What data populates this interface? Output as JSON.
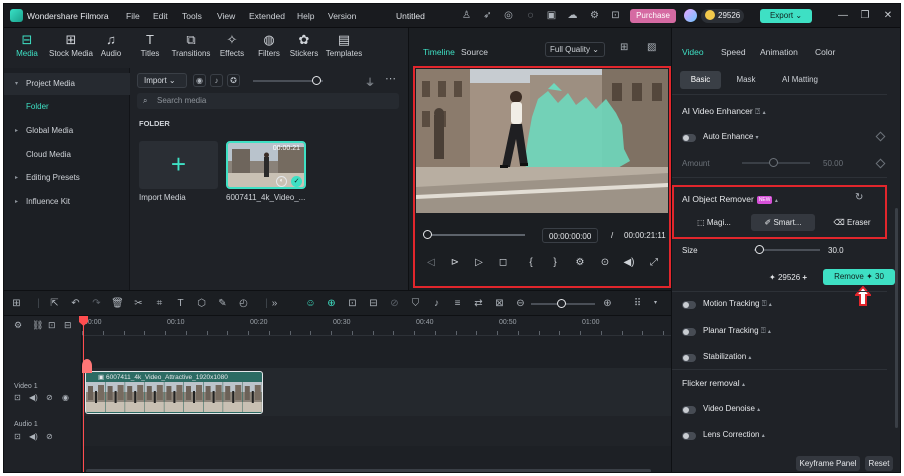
{
  "titlebar": {
    "app_name": "Wondershare Filmora",
    "menu": [
      "File",
      "Edit",
      "Tools",
      "View",
      "Extended",
      "Help",
      "Version"
    ],
    "document_title": "Untitled",
    "purchase": "Purchase",
    "credits": "29526",
    "export": "Export"
  },
  "toolbar": {
    "tools": [
      "Media",
      "Stock Media",
      "Audio",
      "Titles",
      "Transitions",
      "Effects",
      "Filters",
      "Stickers",
      "Templates"
    ],
    "active": "Media"
  },
  "sidebar": {
    "items": [
      {
        "label": "Project Media",
        "arrow": "▾"
      },
      {
        "label": "Folder",
        "arrow": ""
      },
      {
        "label": "Global Media",
        "arrow": "▸"
      },
      {
        "label": "Cloud Media",
        "arrow": ""
      },
      {
        "label": "Editing Presets",
        "arrow": "▸"
      },
      {
        "label": "Influence Kit",
        "arrow": "▸"
      }
    ]
  },
  "media": {
    "import_label": "Import",
    "search_placeholder": "Search media",
    "folder_label": "FOLDER",
    "import_tile_label": "Import Media",
    "clip_label": "6007411_4k_Video_...",
    "clip_duration": "00:00:21"
  },
  "player": {
    "tabs": [
      "Timeline",
      "Source"
    ],
    "quality": "Full Quality",
    "current_time": "00:00:00:00",
    "separator": "/",
    "total_time": "00:00:21:11"
  },
  "right_panel": {
    "tabs": [
      "Video",
      "Speed",
      "Animation",
      "Color"
    ],
    "subtabs": [
      "Basic",
      "Mask",
      "AI Matting"
    ],
    "ai_video_enhancer": "AI Video Enhancer",
    "auto_enhance": "Auto Enhance",
    "amount_label": "Amount",
    "amount_value": "50.00",
    "ai_object_remover": "AI Object Remover",
    "new_badge": "NEW",
    "magic_label": "Magi...",
    "smart_label": "Smart...",
    "eraser_label": "Eraser",
    "size_label": "Size",
    "size_value": "30.0",
    "credit_value": "29526",
    "remove_label": "Remove",
    "remove_cost": "30",
    "motion_tracking": "Motion Tracking",
    "planar_tracking": "Planar Tracking",
    "stabilization": "Stabilization",
    "flicker_removal": "Flicker removal",
    "video_denoise": "Video Denoise",
    "lens_correction": "Lens Correction",
    "keyframe_panel": "Keyframe Panel",
    "reset": "Reset"
  },
  "timeline": {
    "ruler": [
      "00:00",
      "00:10",
      "00:20",
      "00:30",
      "00:40",
      "00:50",
      "01:00"
    ],
    "video_track": "Video 1",
    "audio_track": "Audio 1",
    "clip_name": "6007411_4k_Video_Attractive_1920x1080"
  },
  "colors": {
    "accent": "#3ee0c4",
    "highlight_box": "#e2262c",
    "purchase": "#d56aa2"
  }
}
